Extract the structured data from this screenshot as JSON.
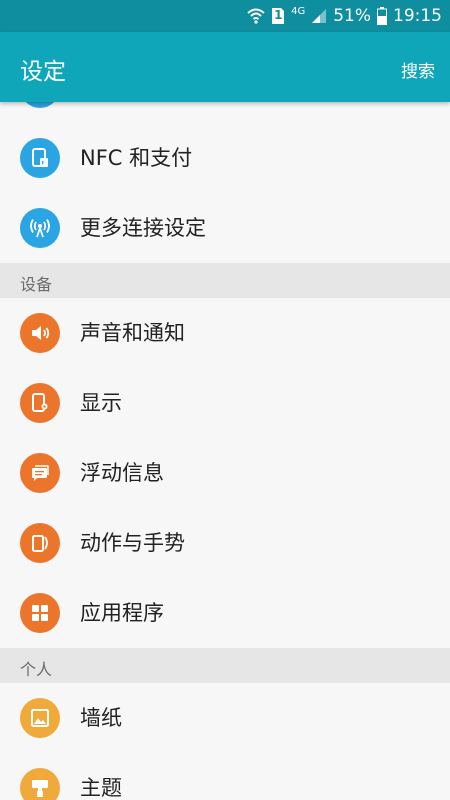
{
  "status_bar": {
    "signal_label": "4G",
    "battery_percent": "51%",
    "time": "19:15",
    "sim_label": "1",
    "icons": [
      "wifi-icon",
      "sim-icon",
      "signal-icon",
      "battery-icon"
    ]
  },
  "app_bar": {
    "title": "设定",
    "search_label": "搜索"
  },
  "sections": {
    "device": "设备",
    "personal": "个人"
  },
  "items": [
    {
      "label": "NFC 和支付",
      "icon": "nfc-icon",
      "color": "#2aa4e2"
    },
    {
      "label": "更多连接设定",
      "icon": "antenna-icon",
      "color": "#2aa4e2"
    },
    {
      "label": "声音和通知",
      "icon": "speaker-icon",
      "color": "#eb762b"
    },
    {
      "label": "显示",
      "icon": "display-icon",
      "color": "#eb762b"
    },
    {
      "label": "浮动信息",
      "icon": "message-icon",
      "color": "#eb762b"
    },
    {
      "label": "动作与手势",
      "icon": "gesture-icon",
      "color": "#eb762b"
    },
    {
      "label": "应用程序",
      "icon": "apps-icon",
      "color": "#eb762b"
    },
    {
      "label": "墙纸",
      "icon": "wallpaper-icon",
      "color": "#f0a93b"
    },
    {
      "label": "主题",
      "icon": "theme-icon",
      "color": "#f0a93b"
    }
  ],
  "colors": {
    "status_bar": "#0f8ea0",
    "app_bar": "#10a6b9",
    "connections": "#2aa4e2",
    "device": "#eb762b",
    "personal": "#f0a93b"
  }
}
